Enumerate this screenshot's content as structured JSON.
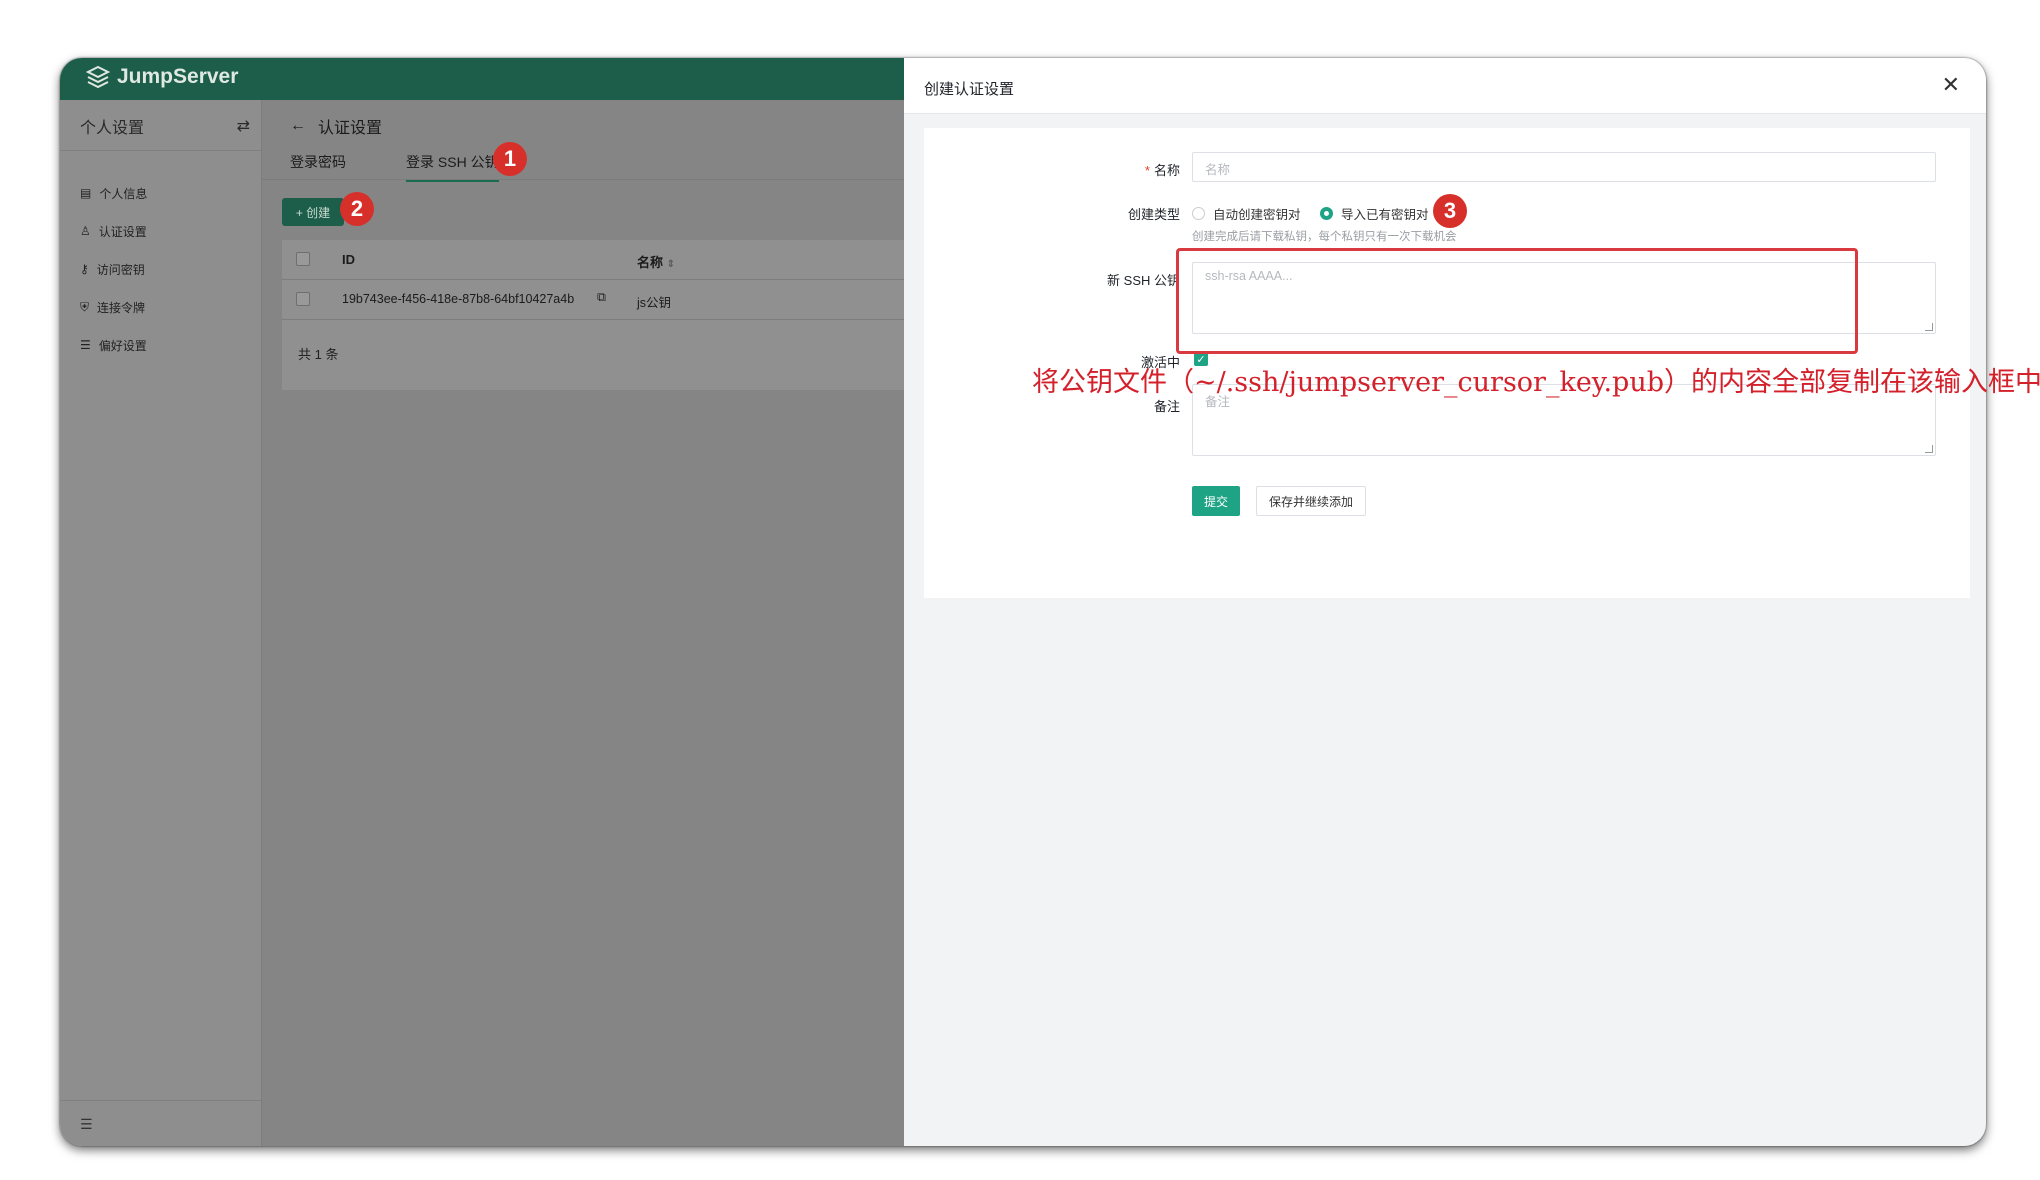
{
  "app": {
    "brand": "JumpServer"
  },
  "sidebar": {
    "title": "个人设置",
    "items": [
      {
        "label": "个人信息",
        "icon": "id-card-icon"
      },
      {
        "label": "认证设置",
        "icon": "user-icon"
      },
      {
        "label": "访问密钥",
        "icon": "key-icon"
      },
      {
        "label": "连接令牌",
        "icon": "shield-icon"
      },
      {
        "label": "偏好设置",
        "icon": "sliders-icon"
      }
    ]
  },
  "main": {
    "breadcrumb": "认证设置",
    "tabs": [
      {
        "label": "登录密码"
      },
      {
        "label": "登录 SSH 公钥"
      }
    ],
    "create_label": "+ 创建",
    "table": {
      "columns": [
        "ID",
        "名称"
      ],
      "rows": [
        {
          "id": "19b743ee-f456-418e-87b8-64bf10427a4b",
          "name": "js公钥"
        }
      ],
      "total": "共 1 条"
    }
  },
  "drawer": {
    "title": "创建认证设置",
    "form": {
      "name_label": "名称",
      "name_placeholder": "名称",
      "type_label": "创建类型",
      "type_options": [
        "自动创建密钥对",
        "导入已有密钥对"
      ],
      "type_selected": "导入已有密钥对",
      "type_hint": "创建完成后请下载私钥，每个私钥只有一次下载机会",
      "key_label": "新 SSH 公钥",
      "key_placeholder": "ssh-rsa AAAA...",
      "active_label": "激活中",
      "active_checked": true,
      "comment_label": "备注",
      "comment_placeholder": "备注",
      "submit_label": "提交",
      "save_continue_label": "保存并继续添加"
    }
  },
  "annotations": {
    "markers": [
      "1",
      "2",
      "3"
    ],
    "instruction": "将公钥文件（~/.ssh/jumpserver_cursor_key.pub）的内容全部复制在该输入框中",
    "color": "#d4202a"
  },
  "colors": {
    "brand": "#1c5e49",
    "primary": "#1fa385",
    "marker": "#d7302a"
  }
}
